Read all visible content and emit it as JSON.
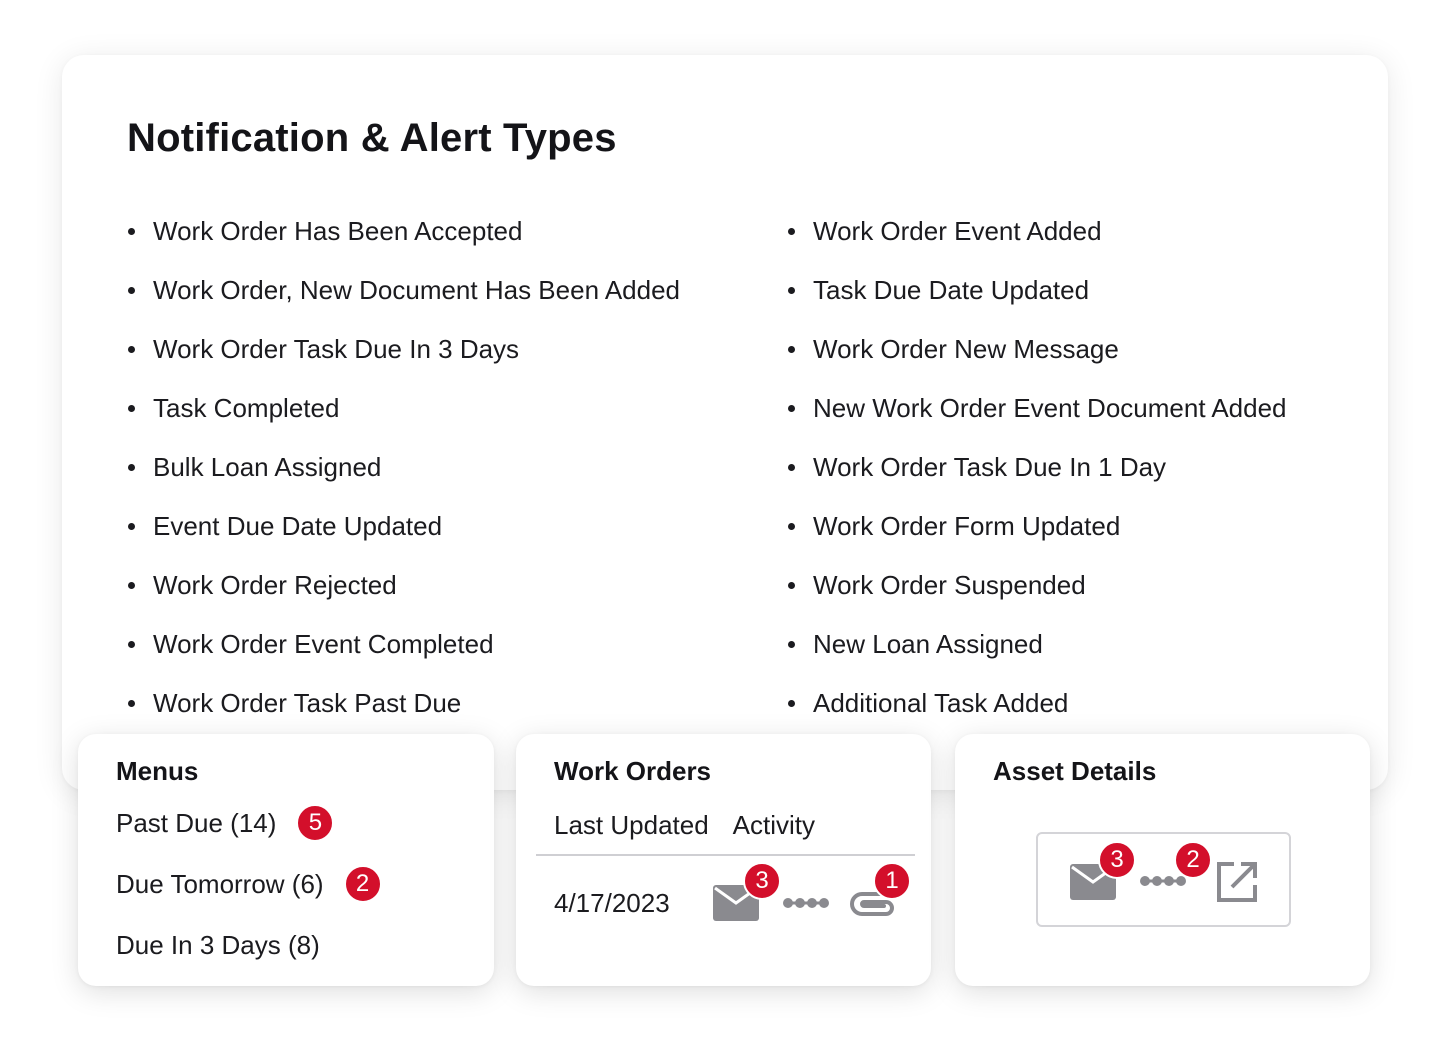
{
  "main": {
    "title": "Notification & Alert Types",
    "left_items": [
      "Work Order Has Been Accepted",
      "Work Order, New Document Has Been Added",
      "Work Order Task Due In 3 Days",
      "Task Completed",
      "Bulk Loan Assigned",
      "Event Due Date Updated",
      "Work Order Rejected",
      "Work Order Event Completed",
      "Work Order Task Past Due"
    ],
    "right_items": [
      "Work Order Event Added",
      "Task Due Date Updated",
      "Work Order New Message",
      "New Work Order Event Document Added",
      "Work Order Task Due In 1 Day",
      "Work Order Form Updated",
      "Work Order Suspended",
      "New Loan Assigned",
      "Additional Task Added"
    ]
  },
  "menus": {
    "title": "Menus",
    "items": [
      {
        "label": "Past Due (14)",
        "badge": "5"
      },
      {
        "label": "Due Tomorrow (6)",
        "badge": "2"
      },
      {
        "label": "Due In 3 Days (8)",
        "badge": ""
      }
    ]
  },
  "work_orders": {
    "title": "Work Orders",
    "col_last_updated": "Last Updated",
    "col_activity": "Activity",
    "row_date": "4/17/2023",
    "message_badge": "3",
    "attachment_badge": "1",
    "icons": [
      "envelope-icon",
      "progress-dots-icon",
      "paperclip-icon"
    ]
  },
  "asset_details": {
    "title": "Asset Details",
    "message_badge": "3",
    "progress_badge": "2",
    "icons": [
      "envelope-icon",
      "progress-dots-icon",
      "external-link-icon"
    ]
  },
  "colors": {
    "badge": "#d30f2b",
    "icon_gray": "#8a8a8f",
    "text": "#1b1b1f"
  }
}
